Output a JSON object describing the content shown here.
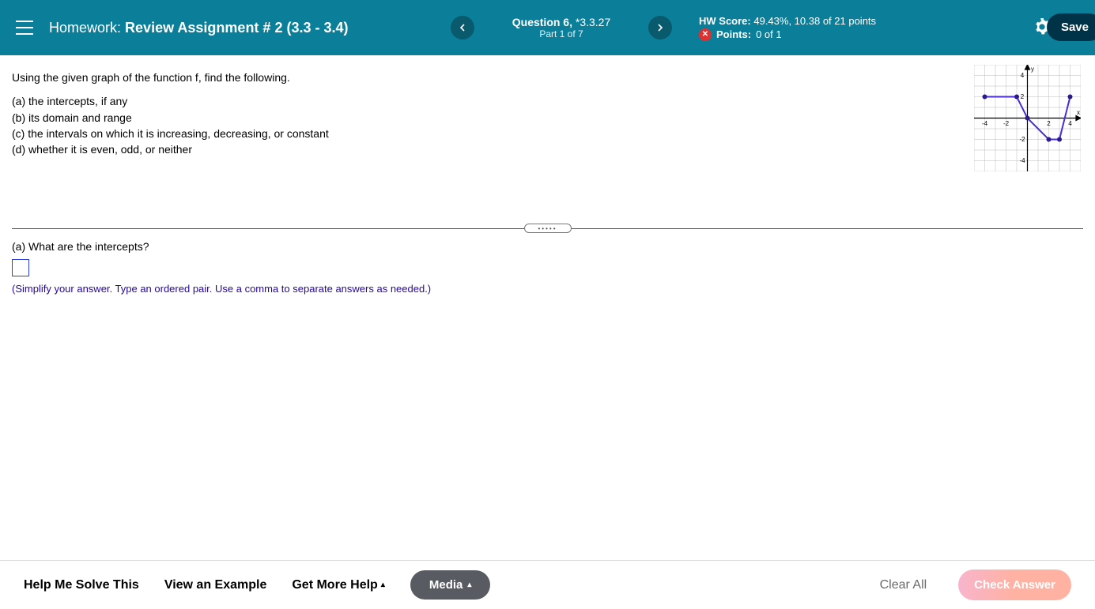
{
  "header": {
    "hw_label": "Homework:",
    "hw_name": "Review Assignment # 2 (3.3 - 3.4)",
    "question_label": "Question 6,",
    "question_ref": "*3.3.27",
    "part_label": "Part 1 of 7",
    "hw_score_label": "HW Score:",
    "hw_score_value": "49.43%, 10.38 of 21 points",
    "points_label": "Points:",
    "points_value": "0 of 1",
    "save_label": "Save"
  },
  "problem": {
    "intro": "Using the given graph of the function f, find the following.",
    "parts": [
      "(a)  the intercepts, if any",
      "(b)  its domain and range",
      "(c)  the intervals on which it is increasing, decreasing, or constant",
      "(d)  whether it is even, odd, or neither"
    ]
  },
  "subquestion": {
    "prompt": "(a)  What are the intercepts?",
    "hint": "(Simplify your answer. Type an ordered pair. Use a comma to separate answers as needed.)"
  },
  "graph": {
    "x_label": "x",
    "y_label": "y",
    "x_range": [
      -5,
      5
    ],
    "y_range": [
      -5,
      5
    ],
    "ticks": {
      "neg4": "-4",
      "neg2": "-2",
      "pos2": "2",
      "pos4": "4"
    },
    "points": [
      [
        -4,
        2
      ],
      [
        -1,
        2
      ],
      [
        0,
        0
      ],
      [
        2,
        -2
      ],
      [
        3,
        -2
      ],
      [
        4,
        2
      ]
    ]
  },
  "footer": {
    "help_me": "Help Me Solve This",
    "view_example": "View an Example",
    "get_more": "Get More Help",
    "media": "Media",
    "clear_all": "Clear All",
    "check_answer": "Check Answer"
  },
  "chart_data": {
    "type": "line",
    "title": "",
    "xlabel": "x",
    "ylabel": "y",
    "series": [
      {
        "name": "f",
        "x": [
          -4,
          -1,
          0,
          2,
          3,
          4
        ],
        "y": [
          2,
          2,
          0,
          -2,
          -2,
          2
        ]
      }
    ],
    "xlim": [
      -5,
      5
    ],
    "ylim": [
      -5,
      5
    ]
  }
}
